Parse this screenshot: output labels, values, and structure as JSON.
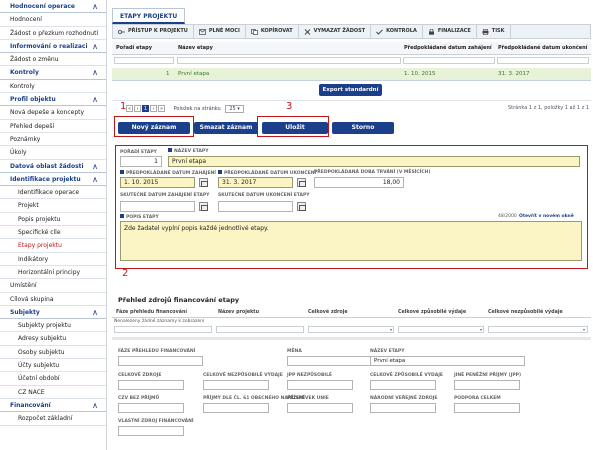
{
  "sidebar": {
    "items": [
      {
        "label": "Hodnocení operace",
        "type": "section",
        "chev": "∧"
      },
      {
        "label": "Hodnocení",
        "type": "item"
      },
      {
        "label": "Žádost o přezkum rozhodnutí",
        "type": "item"
      },
      {
        "label": "Informování o realizaci",
        "type": "section",
        "chev": "∧"
      },
      {
        "label": "Žádost o změnu",
        "type": "item"
      },
      {
        "label": "Kontroly",
        "type": "section",
        "chev": "∧"
      },
      {
        "label": "Kontroly",
        "type": "item"
      },
      {
        "label": "Profil objektu",
        "type": "section",
        "chev": "∧"
      },
      {
        "label": "Nová depeše a koncepty",
        "type": "item"
      },
      {
        "label": "Přehled depeší",
        "type": "item"
      },
      {
        "label": "Poznámky",
        "type": "item"
      },
      {
        "label": "Úkoly",
        "type": "item"
      },
      {
        "label": "Datová oblast žádosti",
        "type": "section",
        "chev": "∧"
      },
      {
        "label": "Identifikace projektu",
        "type": "subsection",
        "chev": "∧"
      },
      {
        "label": "Identifikace operace",
        "type": "sub"
      },
      {
        "label": "Projekt",
        "type": "sub"
      },
      {
        "label": "Popis projektu",
        "type": "sub"
      },
      {
        "label": "Specifické cíle",
        "type": "sub"
      },
      {
        "label": "Etapy projektu",
        "type": "sub",
        "active": true
      },
      {
        "label": "Indikátory",
        "type": "sub"
      },
      {
        "label": "Horizontální principy",
        "type": "sub"
      },
      {
        "label": "Umístění",
        "type": "item"
      },
      {
        "label": "Cílová skupina",
        "type": "item"
      },
      {
        "label": "Subjekty",
        "type": "subsection",
        "chev": "∧"
      },
      {
        "label": "Subjekty projektu",
        "type": "sub"
      },
      {
        "label": "Adresy subjektu",
        "type": "sub"
      },
      {
        "label": "Osoby subjektu",
        "type": "sub"
      },
      {
        "label": "Účty subjektu",
        "type": "sub"
      },
      {
        "label": "Účetní období",
        "type": "sub"
      },
      {
        "label": "CZ NACE",
        "type": "sub"
      },
      {
        "label": "Financování",
        "type": "subsection",
        "chev": "∧"
      },
      {
        "label": "Rozpočet základní",
        "type": "sub"
      }
    ]
  },
  "header": {
    "tab": "ETAPY PROJEKTU"
  },
  "toolbar": {
    "buttons": [
      "PŘÍSTUP K PROJEKTU",
      "PLNÉ MOCI",
      "KOPÍROVAT",
      "VYMAZAT ŽÁDOST",
      "KONTROLA",
      "FINALIZACE",
      "TISK"
    ]
  },
  "grid": {
    "columns": [
      "Pořadí etapy",
      "Název etapy",
      "Předpokládané datum zahájení",
      "Předpokládané datum ukončení"
    ],
    "rows": [
      {
        "order": "1",
        "name": "První etapa",
        "start": "1. 10. 2015",
        "end": "31. 3. 2017"
      }
    ],
    "export_label": "Export standardní"
  },
  "pager": {
    "page": "1",
    "per_page_label": "Položek na stránku",
    "per_page_value": "25",
    "summary": "Stránka 1 z 1, položky 1 až 1 z 1"
  },
  "actions": {
    "new": "Nový záznam",
    "delete": "Smazat záznam",
    "save": "Uložit",
    "cancel": "Storno"
  },
  "annotations": {
    "n1": "1",
    "n2": "2",
    "n3": "3"
  },
  "form": {
    "order_label": "POŘADÍ ETAPY",
    "order_value": "1",
    "name_label": "NÁZEV ETAPY",
    "name_value": "První etapa",
    "start_label": "PŘEDPOKLÁDANÉ DATUM ZAHÁJENÍ",
    "start_value": "1. 10. 2015",
    "end_label": "PŘEDPOKLÁDANÉ DATUM UKONČENÍ",
    "end_value": "31. 3. 2017",
    "duration_label": "PŘEDPOKLÁDANÁ DOBA TRVÁNÍ (V MĚSÍCÍCH)",
    "duration_value": "18,00",
    "actual_start_label": "SKUTEČNÉ DATUM ZAHÁJENÍ ETAPY",
    "actual_end_label": "SKUTEČNÉ DATUM UKONČENÍ ETAPY",
    "desc_label": "POPIS ETAPY",
    "desc_count": "48/2000",
    "desc_link": "Otevřít v novém okně",
    "desc_value": "Zde žadatel vyplní popis každé jednotlivé etapy."
  },
  "finance": {
    "title": "Přehled zdrojů financování etapy",
    "columns": [
      "Fáze přehledu financování",
      "Název projektu",
      "Celkové zdroje",
      "Celkové způsobilé výdaje",
      "Celkové nezpůsobilé výdaje"
    ],
    "empty": "Nenalezeny žádné záznamy k zobrazení",
    "fields": {
      "faze": "FÁZE PŘEHLEDU FINANCOVÁNÍ",
      "mena": "MĚNA",
      "nazev": "NÁZEV ETAPY",
      "nazev_value": "První etapa",
      "celk_zdroje": "CELKOVÉ ZDROJE",
      "celk_nezp": "CELKOVÉ NEZPŮSOBILÉ VÝDAJE",
      "jpp_nezp": "JPP NEZPŮSOBILÉ",
      "celk_zp": "CELKOVÉ ZPŮSOBILÉ VÝDAJE",
      "jine_prijmy": "JINÉ PENĚŽNÍ PŘÍJMY (JPP)",
      "czv": "CZV BEZ PŘÍJMŮ",
      "prijmy_dle": "PŘÍJMY DLE ČL. 61 OBECNÉHO NAŘÍZENÍ",
      "prispevek": "PŘÍSPĚVEK UNIE",
      "narodni": "NÁRODNÍ VEŘEJNÉ ZDROJE",
      "podpora": "PODPORA CELKEM",
      "vlastni": "VLASTNÍ ZDROJ FINANCOVÁNÍ"
    }
  },
  "colors": {
    "accent": "#1b3f8a",
    "highlight_row": "#e8f2d8",
    "required_bg": "#fbf4c4",
    "annotation": "#c0161a"
  }
}
